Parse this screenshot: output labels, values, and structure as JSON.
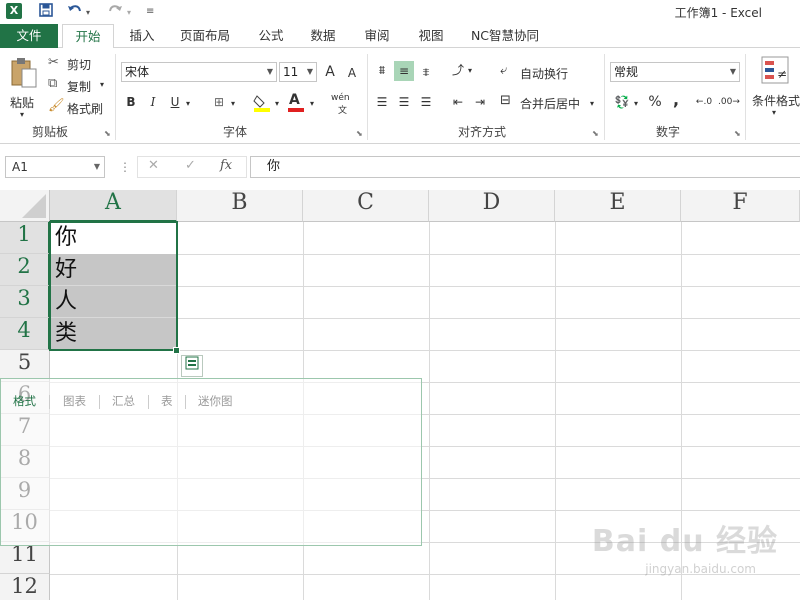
{
  "titlebar": {
    "app_icon": "X",
    "window_title": "工作簿1 - Excel",
    "save_icon": "save-icon",
    "undo_icon": "undo-icon",
    "redo_icon": "redo-icon"
  },
  "tabs": [
    "文件",
    "开始",
    "插入",
    "页面布局",
    "公式",
    "数据",
    "审阅",
    "视图",
    "NC智慧协同"
  ],
  "active_tab": "开始",
  "ribbon": {
    "clipboard": {
      "paste": "粘贴",
      "cut": "剪切",
      "copy": "复制",
      "format_painter": "格式刷",
      "label": "剪贴板"
    },
    "font": {
      "font_name": "宋体",
      "font_size": "11",
      "grow": "A",
      "shrink": "A",
      "bold": "B",
      "italic": "I",
      "underline": "U",
      "phonetic": "wén",
      "label": "字体"
    },
    "alignment": {
      "wrap_text": "自动换行",
      "merge_center": "合并后居中",
      "label": "对齐方式"
    },
    "number": {
      "format": "常规",
      "percent": "%",
      "comma": ",",
      "label": "数字"
    },
    "styles": {
      "conditional_format": "条件格式"
    }
  },
  "formula_bar": {
    "name_box": "A1",
    "cancel": "✕",
    "enter": "✓",
    "fx": "fx",
    "content": "你"
  },
  "grid": {
    "columns": [
      "A",
      "B",
      "C",
      "D",
      "E",
      "F"
    ],
    "selected_column": "A",
    "rows": [
      "1",
      "2",
      "3",
      "4",
      "5",
      "6",
      "7",
      "8",
      "9",
      "10",
      "11",
      "12"
    ],
    "cells": {
      "A1": "你",
      "A2": "好",
      "A3": "人",
      "A4": "类"
    }
  },
  "quick_analysis": {
    "tabs": [
      "格式",
      "图表",
      "汇总",
      "表",
      "迷你图"
    ],
    "active_tab": "格式"
  },
  "watermark": {
    "main": "Bai du 经验",
    "sub": "jingyan.baidu.com"
  }
}
